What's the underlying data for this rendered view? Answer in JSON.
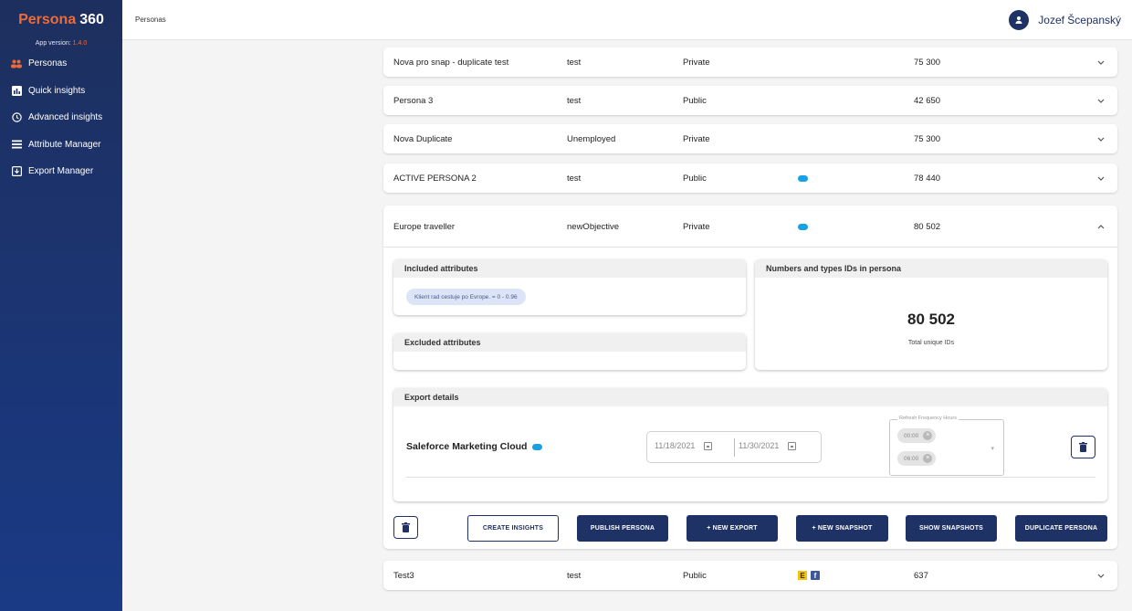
{
  "app": {
    "logo_part1": "Persona",
    "logo_part2": "360",
    "version_label": "App version:",
    "version": "1.4.0"
  },
  "sidebar": {
    "items": [
      {
        "label": "Personas",
        "icon": "people-icon",
        "active": true
      },
      {
        "label": "Quick insights",
        "icon": "chart-icon"
      },
      {
        "label": "Advanced insights",
        "icon": "clock-icon"
      },
      {
        "label": "Attribute Manager",
        "icon": "list-icon"
      },
      {
        "label": "Export Manager",
        "icon": "export-icon"
      }
    ]
  },
  "header": {
    "breadcrumb": "Personas",
    "user_name": "Jozef Šcepanský"
  },
  "rows": [
    {
      "name": "Nova pro snap - duplicate test",
      "objective": "test",
      "visibility": "Private",
      "ids": "75 300"
    },
    {
      "name": "Persona 3",
      "objective": "test",
      "visibility": "Public",
      "ids": "42 650"
    },
    {
      "name": "Nova Duplicate",
      "objective": "Unemployed",
      "visibility": "Private",
      "ids": "75 300"
    },
    {
      "name": "ACTIVE PERSONA 2",
      "objective": "test",
      "visibility": "Public",
      "ids": "78 440",
      "channel": "salesforce-icon"
    }
  ],
  "expanded": {
    "name": "Europe traveller",
    "objective": "newObjective",
    "visibility": "Private",
    "ids": "80 502",
    "included_title": "Included attributes",
    "included_chip": "Klient rad cestuje po Evrope. = 0 - 0.96",
    "excluded_title": "Excluded attributes",
    "numbers_title": "Numbers and types IDs in persona",
    "total_ids": "80 502",
    "total_label": "Total unique IDs",
    "export_title": "Export details",
    "export_name": "Saleforce Marketing Cloud",
    "date_from": "11/18/2021",
    "date_to": "11/30/2021",
    "refresh_label": "Refresh Frequency Hours",
    "refresh_chips": [
      "00:00",
      "06:00"
    ],
    "buttons": {
      "create_insights": "CREATE INSIGHTS",
      "publish": "PUBLISH PERSONA",
      "new_export": "+ NEW EXPORT",
      "new_snapshot": "+ NEW SNAPSHOT",
      "show_snapshots": "SHOW SNAPSHOTS",
      "duplicate": "DUPLICATE PERSONA"
    }
  },
  "last_row": {
    "name": "Test3",
    "objective": "test",
    "visibility": "Public",
    "ids": "637",
    "channels": [
      "e-icon",
      "facebook-icon"
    ],
    "e_letter": "E",
    "f_letter": "f"
  },
  "colors": {
    "accent": "#f06a35",
    "navy": "#1f3266",
    "salesforce": "#1ba1e2"
  }
}
